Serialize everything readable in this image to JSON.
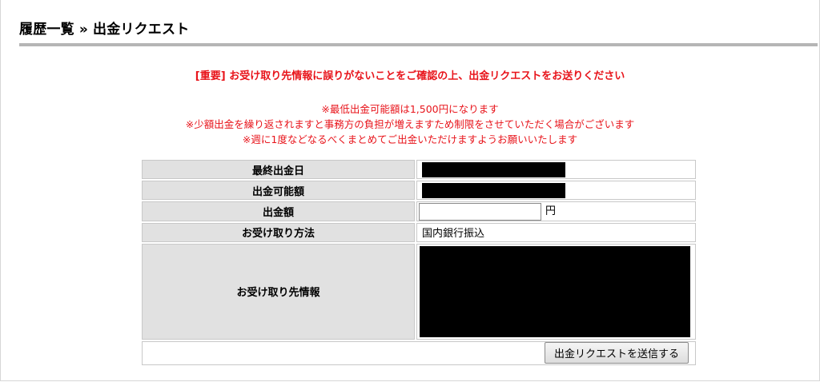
{
  "breadcrumb": {
    "parent": "履歴一覧",
    "separator": "»",
    "current": "出金リクエスト"
  },
  "notices": {
    "important": "[重要] お受け取り先情報に誤りがないことをご確認の上、出金リクエストをお送りください",
    "lines": [
      "※最低出金可能額は1,500円になります",
      "※少額出金を繰り返されますと事務方の負担が増えますため制限をさせていただく場合がございます",
      "※週に1度などなるべくまとめてご出金いただけますようお願いいたします"
    ]
  },
  "form": {
    "last_withdrawal_label": "最終出金日",
    "available_label": "出金可能額",
    "amount_label": "出金額",
    "amount_value": "",
    "amount_unit": "円",
    "method_label": "お受け取り方法",
    "method_value": "国内銀行振込",
    "recipient_label": "お受け取り先情報",
    "submit_label": "出金リクエストを送信する"
  },
  "colors": {
    "notice_red": "#e8141b",
    "label_bg": "#e1e1e1",
    "rule_gray": "#b5b5b5",
    "redacted": "#000000"
  }
}
